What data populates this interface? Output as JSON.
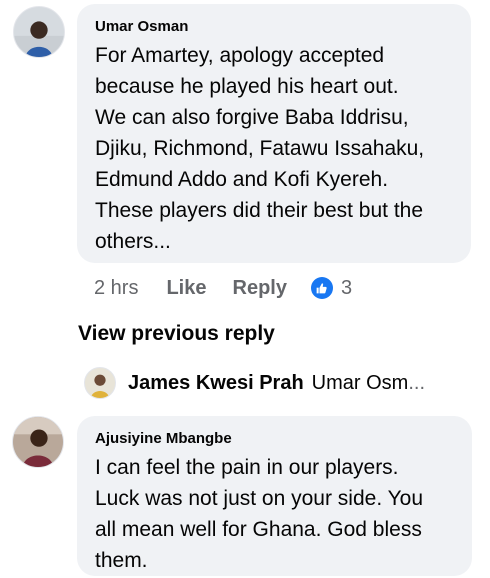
{
  "comments": [
    {
      "author": "Umar Osman",
      "text": "For Amartey, apology accepted because he played his heart out. We can also forgive Baba Iddrisu, Djiku, Richmond, Fatawu Issahaku, Edmund Addo and Kofi Kyereh. These players did their best but the others...",
      "lines": [
        "For Amartey, apology accepted",
        "because he played his heart out.",
        "We can also forgive Baba Iddrisu,",
        "Djiku, Richmond, Fatawu Issahaku,",
        "Edmund Addo and Kofi Kyereh.",
        "These players did their best but the",
        "others..."
      ],
      "time": "2 hrs",
      "like_label": "Like",
      "reply_label": "Reply",
      "reaction_icon": "like-icon",
      "reaction_color": "#1877f2",
      "reaction_count": "3"
    },
    {
      "author": "Ajusiyine Mbangbe",
      "lines": [
        "I can feel the pain in our players.",
        "Luck was not just on your side. You",
        "all mean well for Ghana. God bless",
        "them."
      ]
    }
  ],
  "view_previous_reply": "View previous reply",
  "reply_preview": {
    "author": "James Kwesi Prah",
    "text": "Umar Osm",
    "ellipsis": "..."
  },
  "colors": {
    "bubble_bg": "#f0f2f5",
    "text": "#050505",
    "secondary_text": "#65676b",
    "accent": "#1877f2"
  }
}
